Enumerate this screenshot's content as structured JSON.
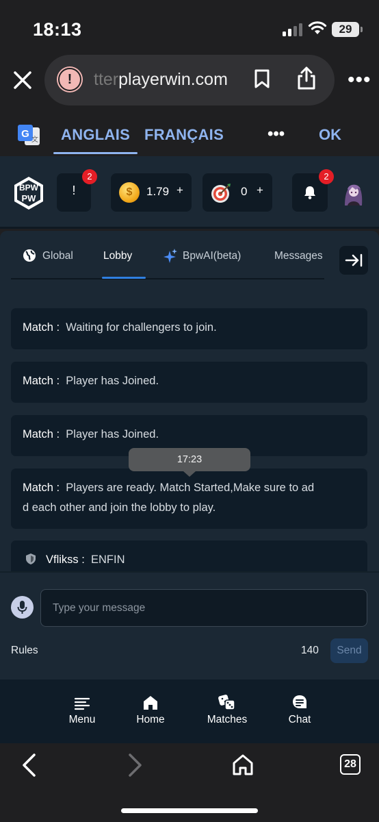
{
  "status_bar": {
    "time": "18:13",
    "battery": "29"
  },
  "browser": {
    "url_faded": "tter",
    "url_main": "playerwin.com"
  },
  "translate_bar": {
    "lang_source": "ANGLAIS",
    "lang_target": "FRANÇAIS",
    "more": "•••",
    "ok": "OK"
  },
  "header": {
    "logo_text": "BPW",
    "alert_label": "!",
    "alert_badge": "2",
    "coins_value": "1.79",
    "coins_plus": "+",
    "target_value": "0",
    "target_plus": "+",
    "bell_badge": "2"
  },
  "tabs": [
    {
      "label": "Global",
      "icon": "globe-icon"
    },
    {
      "label": "Lobby",
      "active": true
    },
    {
      "label": "BpwAI(beta)",
      "icon": "sparkle-icon"
    },
    {
      "label": "Messages"
    }
  ],
  "messages": [
    {
      "sender": "Match :",
      "text": "Waiting for challengers to join."
    },
    {
      "sender": "Match :",
      "text": "Player has Joined."
    },
    {
      "sender": "Match :",
      "text": "Player has Joined."
    },
    {
      "sender": "Match :",
      "text": "Players are ready. Match Started,Make sure to ad",
      "text2": "d each other and join the lobby to play."
    },
    {
      "sender": "Vflikss :",
      "text": "ENFIN"
    }
  ],
  "tooltip": "17:23",
  "composer": {
    "placeholder": "Type your message",
    "rules": "Rules",
    "char_count": "140",
    "send": "Send"
  },
  "bottom_nav": [
    {
      "label": "Menu",
      "icon": "menu-icon"
    },
    {
      "label": "Home",
      "icon": "home-icon"
    },
    {
      "label": "Matches",
      "icon": "dice-icon"
    },
    {
      "label": "Chat",
      "icon": "chat-icon"
    }
  ],
  "safari": {
    "tab_count": "28"
  },
  "colors": {
    "accent": "#2f7fe0",
    "translate_blue": "#8fb4ef",
    "badge_red": "#e41e26",
    "panel": "#1b2834",
    "bubble": "#0f1c28"
  }
}
